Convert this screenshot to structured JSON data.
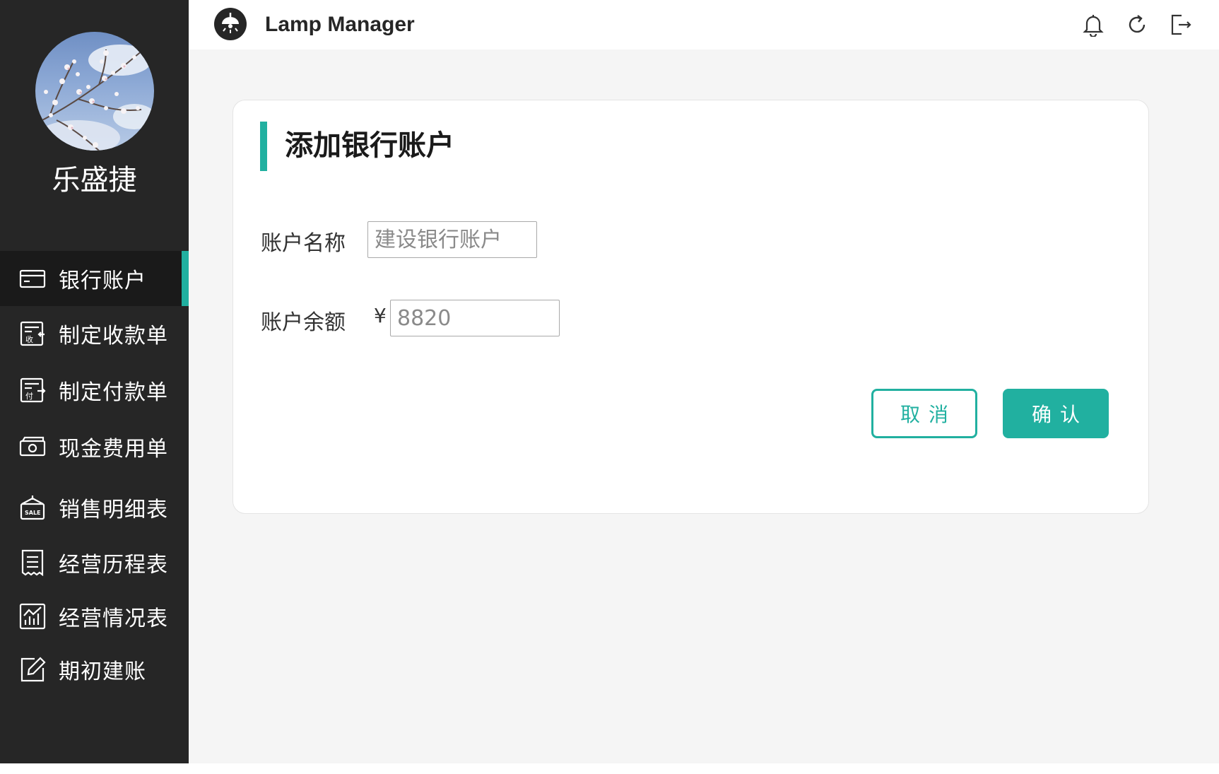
{
  "app": {
    "title": "Lamp Manager",
    "logo_icon": "lamp-logo-icon"
  },
  "header": {
    "icons": [
      "bell-icon",
      "refresh-icon",
      "logout-icon"
    ]
  },
  "user": {
    "name": "乐盛捷"
  },
  "sidebar": {
    "items": [
      {
        "label": "银行账户",
        "icon": "bank-card-icon",
        "active": true
      },
      {
        "label": "制定收款单",
        "icon": "receipt-in-icon",
        "active": false
      },
      {
        "label": "制定付款单",
        "icon": "receipt-out-icon",
        "active": false
      },
      {
        "label": "现金费用单",
        "icon": "cash-icon",
        "active": false
      },
      {
        "label": "销售明细表",
        "icon": "sale-tag-icon",
        "active": false
      },
      {
        "label": "经营历程表",
        "icon": "document-list-icon",
        "active": false
      },
      {
        "label": "经营情况表",
        "icon": "chart-icon",
        "active": false
      },
      {
        "label": "期初建账",
        "icon": "edit-icon",
        "active": false
      }
    ]
  },
  "form": {
    "title": "添加银行账户",
    "account_name_label": "账户名称",
    "account_name_placeholder": "建设银行账户",
    "account_balance_label": "账户余额",
    "currency_symbol": "¥",
    "account_balance_placeholder": "8820",
    "cancel_label": "取消",
    "confirm_label": "确认"
  },
  "colors": {
    "accent": "#21b0a0",
    "sidebar_bg": "#262626",
    "sidebar_active_bg": "#1a1a1a",
    "main_bg": "#f5f5f5"
  }
}
